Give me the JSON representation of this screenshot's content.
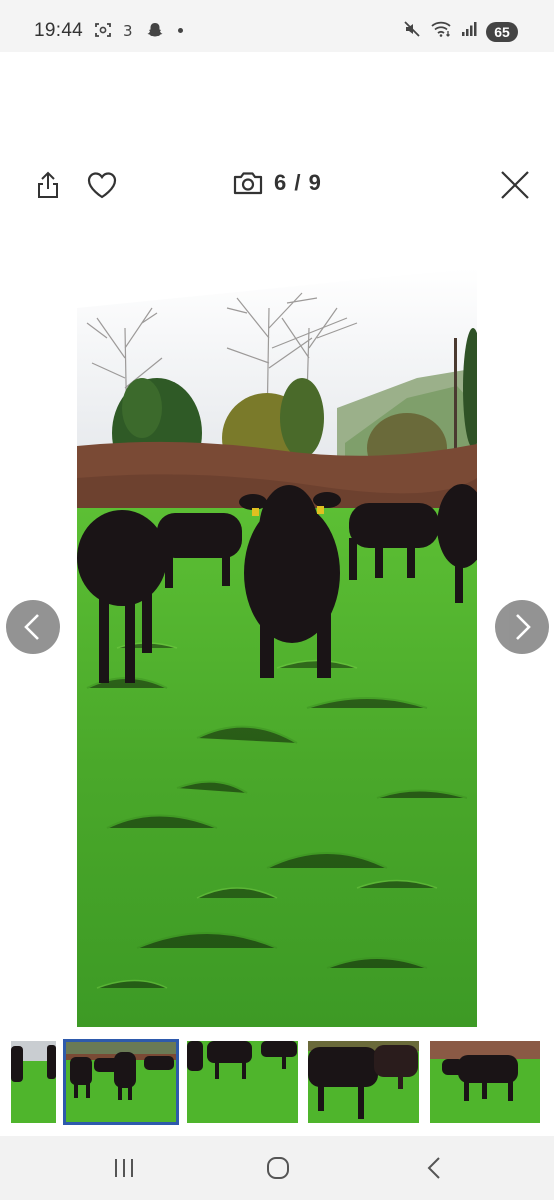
{
  "status_bar": {
    "time": "19:44",
    "battery": "65",
    "icons_left": [
      "screenshot-icon",
      "three-network-icon",
      "snapchat-icon",
      "notification-dot"
    ],
    "icons_right": [
      "mute-icon",
      "wifi-icon",
      "signal-icon",
      "battery-icon"
    ]
  },
  "toolbar": {
    "share_icon": "share-icon",
    "favorite_icon": "heart-icon",
    "camera_icon": "camera-icon",
    "counter": "6 / 9",
    "close_icon": "close-icon"
  },
  "gallery": {
    "main_photo_alt": "",
    "prev_icon": "chevron-left-icon",
    "next_icon": "chevron-right-icon",
    "thumbnails_count": 5,
    "active_thumbnail_index": 1
  },
  "nav_bar": {
    "recents_icon": "recents-icon",
    "home_icon": "home-icon",
    "back_icon": "back-icon"
  },
  "colors": {
    "active_thumb_border": "#2e5aac",
    "nav_button": "#888888",
    "grass": "#4fb52c",
    "cattle": "#1a1416"
  }
}
